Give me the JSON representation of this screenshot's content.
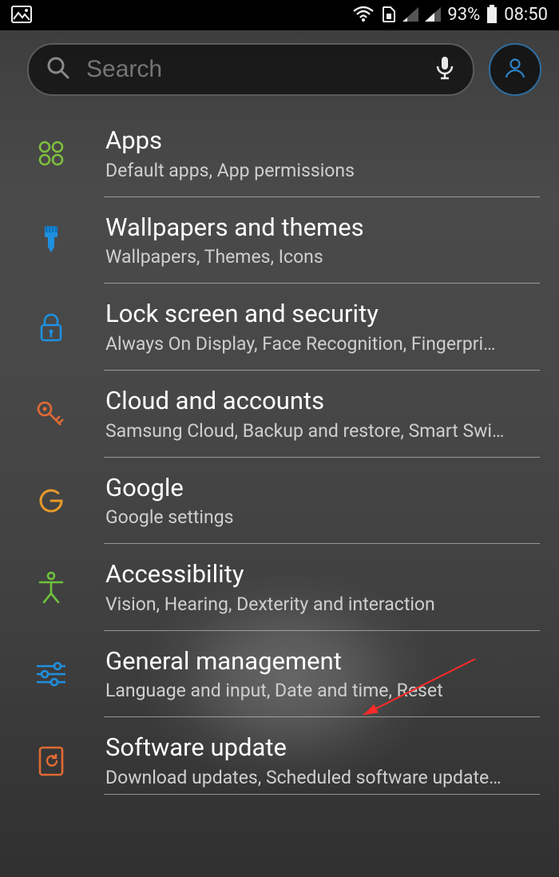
{
  "status": {
    "battery_pct": "93%",
    "clock": "08:50"
  },
  "search": {
    "placeholder": "Search"
  },
  "items": [
    {
      "id": "apps",
      "icon_name": "apps-grid-icon",
      "title": "Apps",
      "subtitle": "Default apps, App permissions"
    },
    {
      "id": "wallpapers",
      "icon_name": "brush-icon",
      "title": "Wallpapers and themes",
      "subtitle": "Wallpapers, Themes, Icons"
    },
    {
      "id": "lock",
      "icon_name": "lock-icon",
      "title": "Lock screen and security",
      "subtitle": "Always On Display, Face Recognition, Fingerpri…"
    },
    {
      "id": "cloud",
      "icon_name": "key-icon",
      "title": "Cloud and accounts",
      "subtitle": "Samsung Cloud, Backup and restore, Smart Swi…"
    },
    {
      "id": "google",
      "icon_name": "google-g-icon",
      "title": "Google",
      "subtitle": "Google settings"
    },
    {
      "id": "accessibility",
      "icon_name": "person-icon",
      "title": "Accessibility",
      "subtitle": "Vision, Hearing, Dexterity and interaction"
    },
    {
      "id": "general",
      "icon_name": "sliders-icon",
      "title": "General management",
      "subtitle": "Language and input, Date and time, Reset"
    },
    {
      "id": "update",
      "icon_name": "update-icon",
      "title": "Software update",
      "subtitle": "Download updates, Scheduled software update…"
    }
  ]
}
